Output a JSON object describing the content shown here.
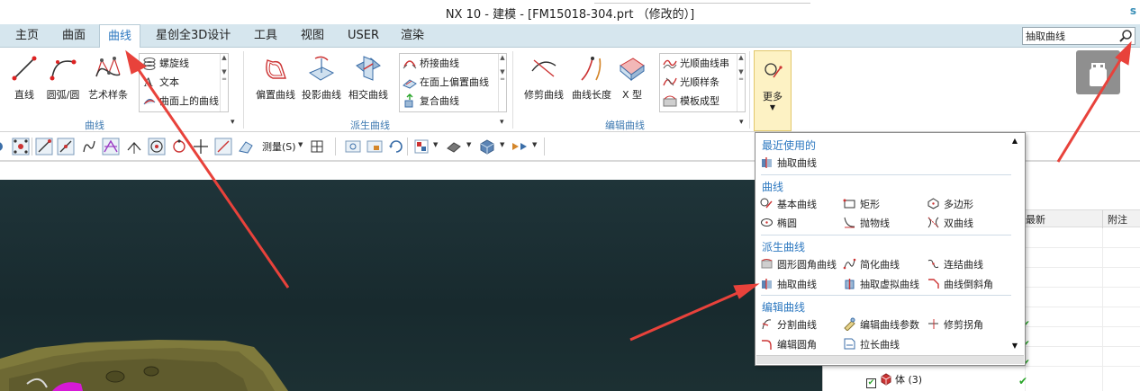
{
  "titlebar": {
    "title": "NX 10 - 建模 - [FM15018-304.prt （修改的）]",
    "brand": "s"
  },
  "menu": {
    "tabs": [
      "主页",
      "曲面",
      "曲线",
      "星创全3D设计",
      "工具",
      "视图",
      "USER",
      "渲染"
    ],
    "active_tab": "曲线"
  },
  "search": {
    "value": "抽取曲线",
    "icon": "search-icon"
  },
  "ribbon": {
    "curve_group": {
      "label": "曲线",
      "buttons": [
        "直线",
        "圆弧/圆",
        "艺术样条"
      ],
      "gallery": [
        "螺旋线",
        "文本",
        "曲面上的曲线"
      ]
    },
    "derived_group": {
      "label": "派生曲线",
      "buttons": [
        "偏置曲线",
        "投影曲线",
        "相交曲线"
      ],
      "gallery": [
        "桥接曲线",
        "在面上偏置曲线",
        "复合曲线"
      ]
    },
    "edit_group": {
      "label": "编辑曲线",
      "buttons": [
        "修剪曲线",
        "曲线长度",
        "X 型"
      ],
      "gallery": [
        "光顺曲线串",
        "光顺样条",
        "模板成型"
      ]
    },
    "more": {
      "label": "更多"
    }
  },
  "toolbar2": {
    "measure_label": "测量(S)"
  },
  "dropdown": {
    "sections": [
      {
        "title": "最近使用的",
        "items": [
          "抽取曲线"
        ]
      },
      {
        "title": "曲线",
        "items": [
          "基本曲线",
          "矩形",
          "多边形",
          "椭圆",
          "抛物线",
          "双曲线"
        ]
      },
      {
        "title": "派生曲线",
        "items": [
          "圆形圆角曲线",
          "简化曲线",
          "连结曲线",
          "抽取曲线",
          "抽取虚拟曲线",
          "曲线倒斜角"
        ]
      },
      {
        "title": "编辑曲线",
        "items": [
          "分割曲线",
          "编辑曲线参数",
          "修剪拐角",
          "编辑圆角",
          "拉长曲线"
        ]
      }
    ]
  },
  "navigator": {
    "columns": [
      "最新",
      "附注"
    ],
    "visible_row": {
      "label": "体 (3)"
    }
  },
  "colors": {
    "menubar_bg": "#d6e6ee",
    "active_tab_text": "#2d78c0",
    "annotation_arrow": "#e8423b",
    "viewport_bg": "#1b2e32"
  }
}
